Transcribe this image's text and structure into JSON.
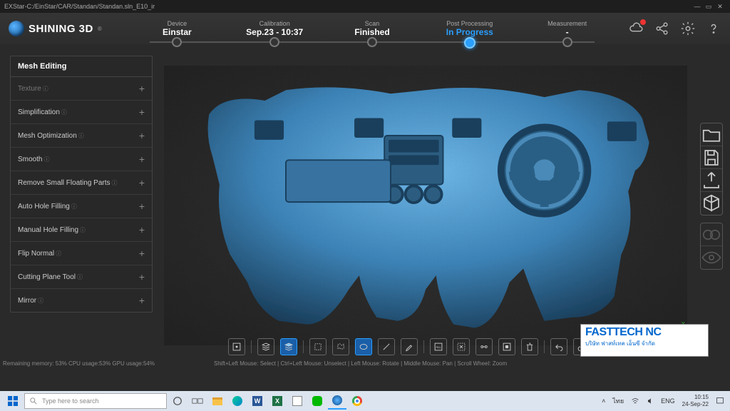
{
  "titlebar": {
    "app": "EXStar",
    "sep": "  -  ",
    "path": "C:/EinStar/CAR/Standan/Standan.sln_E10_ir"
  },
  "brand": {
    "name": "SHINING 3D",
    "reg": "®"
  },
  "steps": [
    {
      "label": "Device",
      "value": "Einstar"
    },
    {
      "label": "Calibration",
      "value": "Sep.23 - 10:37"
    },
    {
      "label": "Scan",
      "value": "Finished"
    },
    {
      "label": "Post Processing",
      "value": "In Progress"
    },
    {
      "label": "Measurement",
      "value": "-"
    }
  ],
  "active_step_index": 3,
  "sidepanel": {
    "title": "Mesh Editing",
    "rows": [
      {
        "label": "Texture",
        "disabled": true
      },
      {
        "label": "Simplification"
      },
      {
        "label": "Mesh Optimization"
      },
      {
        "label": "Smooth"
      },
      {
        "label": "Remove Small Floating Parts"
      },
      {
        "label": "Auto Hole Filling"
      },
      {
        "label": "Manual Hole Filling"
      },
      {
        "label": "Flip Normal"
      },
      {
        "label": "Cutting Plane Tool"
      },
      {
        "label": "Mirror"
      }
    ]
  },
  "hint": "Shift+Left Mouse: Select | Ctrl+Left Mouse: Unselect | Left Mouse: Rotate | Middle Mouse: Pan | Scroll Wheel: Zoom",
  "memline": "Remaining memory: 53% CPU usage:53%  GPU usage:54%",
  "watermark": {
    "l1a": "FAST",
    "l1b": "TECH",
    "l1c": " NC",
    "l2": "บริษัท  ฟาสท์เทค  เอ็นซี  จำกัด"
  },
  "taskbar": {
    "search_placeholder": "Type here to search",
    "lang1": "ไทย",
    "lang2": "ENG",
    "time": "10:15",
    "date": "24-Sep-22"
  }
}
